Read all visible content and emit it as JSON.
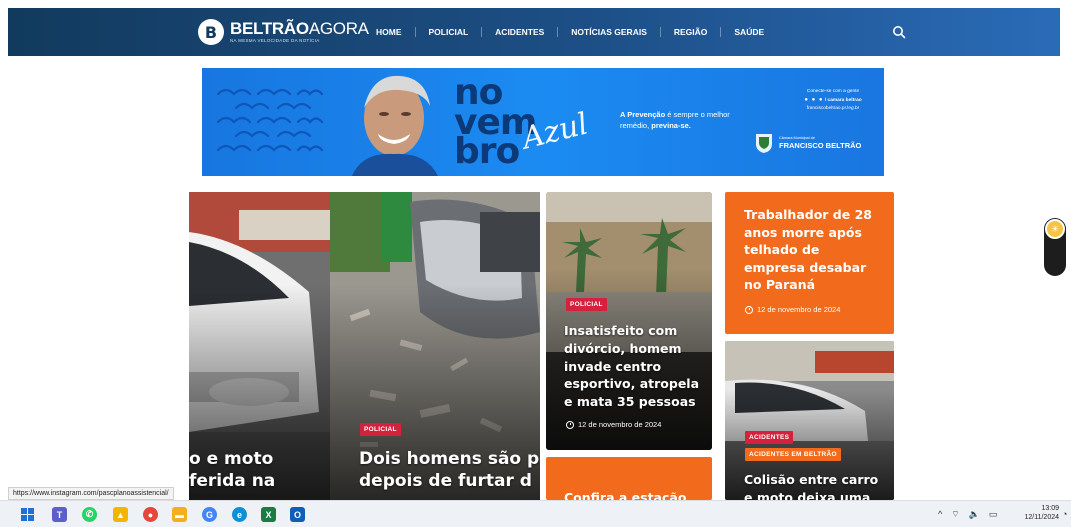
{
  "header": {
    "logo_mark": "B",
    "logo_bold": "BELTRÃO",
    "logo_light": "AGORA",
    "logo_tagline": "NA MESMA VELOCIDADE DA NOTÍCIA",
    "nav": [
      "HOME",
      "POLICIAL",
      "ACIDENTES",
      "NOTÍCIAS GERAIS",
      "REGIÃO",
      "SAÚDE"
    ],
    "search_icon": "search-icon"
  },
  "banner": {
    "title_lines": [
      "no",
      "vem",
      "bro"
    ],
    "script_word": "Azul",
    "prevention_line1_bold": "A Prevenção",
    "prevention_line1_rest": " é sempre o melhor",
    "prevention_line2": "remédio, ",
    "prevention_line2_bold": "previna-se.",
    "contact_line1": "Conecte-se com a gente",
    "contact_line2": "/ camara beltrao",
    "contact_line3": "franciscobeltrao.pr.leg.br",
    "pref_small": "Câmara Municipal de",
    "pref_big": "FRANCISCO BELTRÃO"
  },
  "cards": [
    {
      "headline_lines": [
        "o e moto",
        "ferida na"
      ]
    },
    {
      "tag": "POLICIAL",
      "headline_lines": [
        "Dois homens são p",
        "depois de furtar d"
      ]
    },
    {
      "tag": "POLICIAL",
      "headline": "Insatisfeito com divórcio, homem invade centro esportivo, atropela e mata 35 pessoas",
      "date": "12 de novembro de 2024"
    },
    {
      "headline": "Trabalhador de 28 anos morre após telhado de empresa desabar no Paraná",
      "date": "12 de novembro de 2024"
    },
    {
      "tags": [
        "ACIDENTES",
        "ACIDENTES EM BELTRÃO"
      ],
      "headline_lines": [
        "Colisão entre carro",
        "e moto deixa uma"
      ]
    },
    {
      "headline_lines": [
        "Confira a estação"
      ]
    }
  ],
  "status_url": "https://www.instagram.com/pascplanoassistencial/",
  "taskbar": {
    "time": "13:09",
    "date": "12/11/2024",
    "tray_chevron": "^"
  },
  "colors": {
    "header_dark": "#123a5e",
    "banner_blue": "#1b8bf2",
    "orange": "#f26a1b",
    "tag_red": "#d4223d"
  }
}
